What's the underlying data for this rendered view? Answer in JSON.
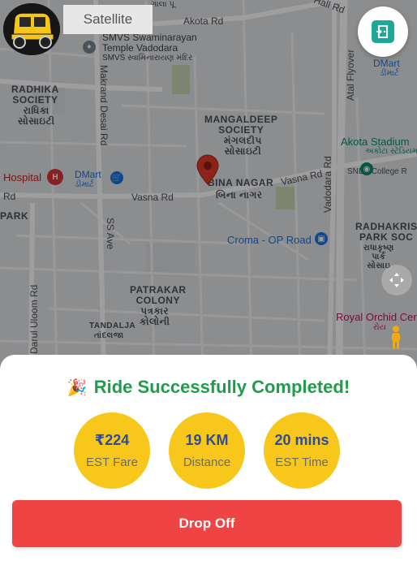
{
  "map": {
    "type_toggle": "Satellite",
    "labels": {
      "radhika": "RADHIKA\nSOCIETY",
      "radhika_guj": "રાધિકા\nસોસાઇટી",
      "mangaldeep": "MANGALDEEP\nSOCIETY",
      "mangaldeep_guj": "મંગલદીપ\nસોસાઇટી",
      "bina_nagar": "BINA NAGAR",
      "bina_nagar_guj": "બિના નાગર",
      "patrakar": "PATRAKAR\nCOLONY",
      "patrakar_guj": "પત્રકાર\nકોલોની",
      "tandalja": "TANDALJA",
      "tandalja_guj": "તાંદલજા",
      "radhakrishna": "RADHAKRIS\nPARK SOC",
      "radhakrishna_guj": "રાધાકૃષ્ણ\nપાર્ક\nસોસાઇ",
      "park": "PARK",
      "swaminarayan": "SMVS Swaminarayan\nTemple Vadodara",
      "swaminarayan_guj": "SMVS સ્વામિનારાયણ મંદિર",
      "akota_stadium": "Akota Stadium",
      "akota_stadium_guj": "અકોટા સ્ટેડિયમ",
      "sndt": "SNDT College R",
      "dmart_left": "DMart",
      "dmart_left_guj": "ડીમાર્ટ",
      "dmart_right": "DMart",
      "dmart_right_guj": "ડીમાર્ટ",
      "hospital": "Hospital",
      "croma": "Croma - OP Road",
      "royal_orchid": "Royal Orchid Cer",
      "royal_orchid_guj": "રોય",
      "akota_rd": "Akota Rd",
      "hall_rd": "Hall Rd",
      "vasna_rd_left": "Vasna Rd",
      "vasna_rd_right": "Vasna Rd",
      "rd_left": "Rd",
      "makrand": "Makrand Desai Rd",
      "ss_ave": "SS Ave",
      "darul_uloom": "Darul Uloom Rd",
      "vadodara_rd": "Vadodara Rd",
      "atal_flyover": "Atal Flyover",
      "top_guj": "ગાલા પૂ"
    }
  },
  "summary": {
    "title": "Ride Successfully Completed!",
    "stats": [
      {
        "value": "₹224",
        "label": "EST Fare"
      },
      {
        "value": "19 KM",
        "label": "Distance"
      },
      {
        "value": "20 mins",
        "label": "EST Time"
      }
    ],
    "action_label": "Drop Off"
  },
  "colors": {
    "title_green": "#1e9e4a",
    "stat_yellow": "#f8c71b",
    "stat_value_blue": "#2d4d9a",
    "button_red": "#ee4444"
  },
  "icons": [
    "auto-rickshaw-logo-icon",
    "exit-door-icon",
    "location-pin-icon",
    "recenter-icon",
    "pegman-icon",
    "party-popper-icon"
  ]
}
